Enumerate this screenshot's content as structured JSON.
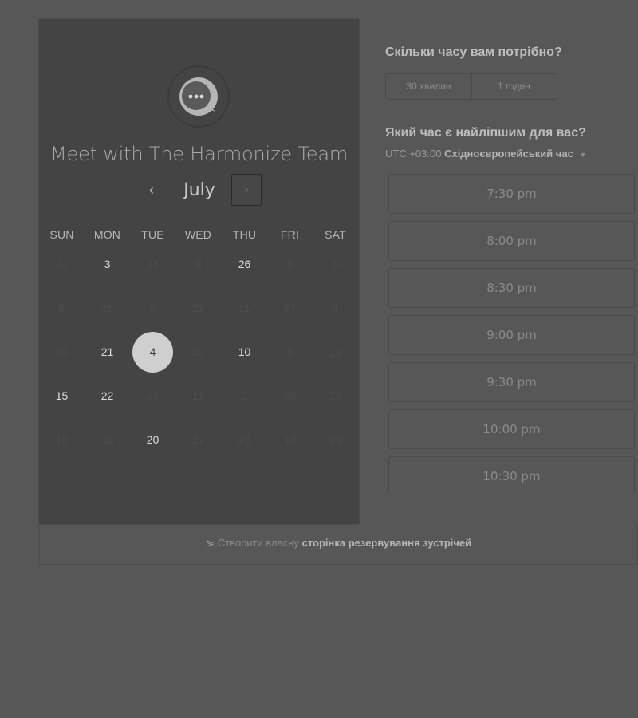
{
  "calendar": {
    "title": "Meet with The Harmonize Team",
    "month": "July",
    "prev_icon": "‹",
    "next_icon": "›",
    "weekdays": [
      "SUN",
      "MON",
      "TUE",
      "WED",
      "THU",
      "FRI",
      "SAT"
    ],
    "weeks": [
      [
        "21",
        "3",
        "24",
        "9",
        "26",
        "5",
        "8"
      ],
      [
        "9",
        "16",
        "8",
        "21",
        "11",
        "27",
        "3"
      ],
      [
        "28",
        "21",
        "4",
        "28",
        "10",
        "5",
        "13"
      ],
      [
        "15",
        "22",
        "29",
        "11",
        "2",
        "26",
        "28"
      ],
      [
        "18",
        "15",
        "20",
        "27",
        "29",
        "14",
        "29"
      ]
    ],
    "available": [
      [
        0,
        1
      ],
      [
        0,
        4
      ],
      [
        2,
        1
      ],
      [
        2,
        2
      ],
      [
        2,
        4
      ],
      [
        3,
        0
      ],
      [
        3,
        1
      ],
      [
        4,
        2
      ]
    ],
    "selected": [
      2,
      2
    ]
  },
  "duration": {
    "question": "Скільки часу вам потрібно?",
    "options": [
      "30 хвилин",
      "1 годин"
    ]
  },
  "time": {
    "question": "Який час є найліпшим для вас?",
    "tz_offset": "UTC +03:00",
    "tz_name": "Східноєвропейський час",
    "slots": [
      "7:30 pm",
      "8:00 pm",
      "8:30 pm",
      "9:00 pm",
      "9:30 pm",
      "10:00 pm",
      "10:30 pm"
    ]
  },
  "footer": {
    "icon": "⋟",
    "prefix": "Створити власну",
    "link": "сторінка резервування зустрічей"
  }
}
